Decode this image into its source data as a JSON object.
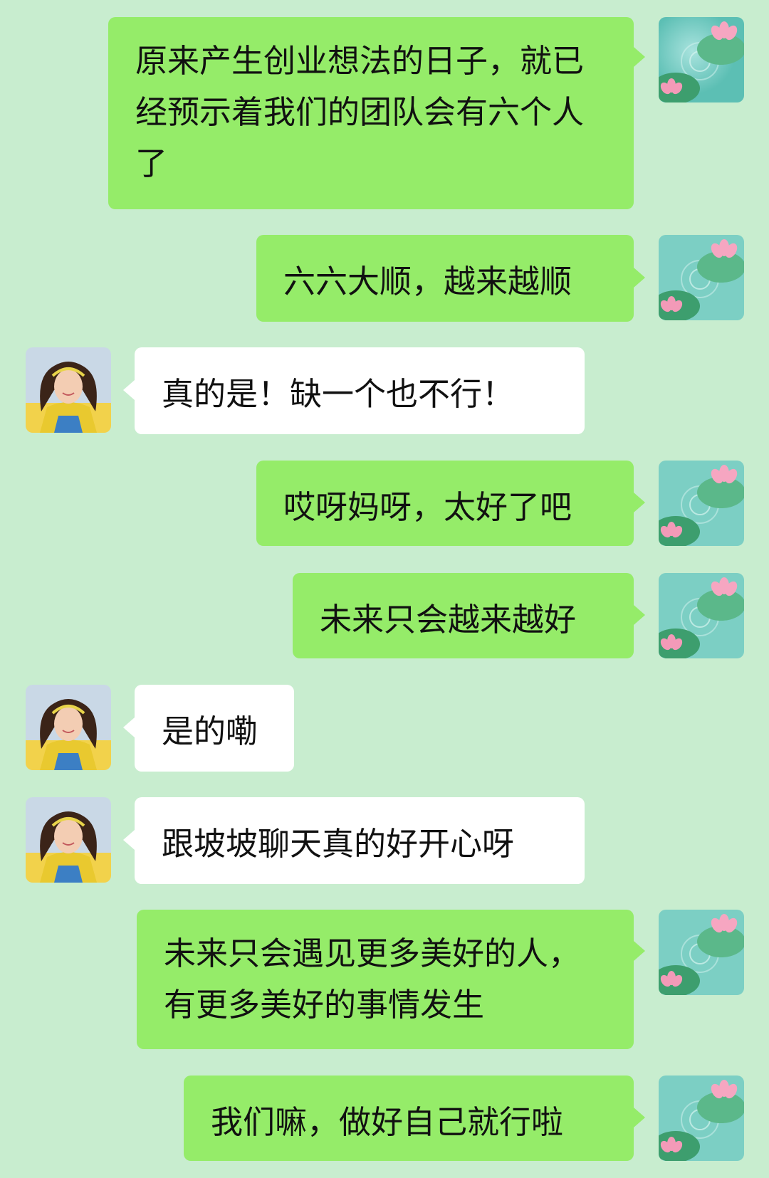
{
  "colors": {
    "background": "#c8edcf",
    "outgoing_bubble": "#95ec69",
    "incoming_bubble": "#ffffff"
  },
  "avatars": {
    "self": "lotus-pond-avatar",
    "other": "girl-portrait-avatar"
  },
  "messages": [
    {
      "sender": "self",
      "text": "原来产生创业想法的日子，就已经预示着我们的团队会有六个人了"
    },
    {
      "sender": "self",
      "text": "六六大顺，越来越顺"
    },
    {
      "sender": "other",
      "text": "真的是！缺一个也不行！"
    },
    {
      "sender": "self",
      "text": "哎呀妈呀，太好了吧"
    },
    {
      "sender": "self",
      "text": "未来只会越来越好"
    },
    {
      "sender": "other",
      "text": "是的嘞"
    },
    {
      "sender": "other",
      "text": "跟坡坡聊天真的好开心呀"
    },
    {
      "sender": "self",
      "text": "未来只会遇见更多美好的人，有更多美好的事情发生"
    },
    {
      "sender": "self",
      "text": "我们嘛，做好自己就行啦"
    }
  ]
}
